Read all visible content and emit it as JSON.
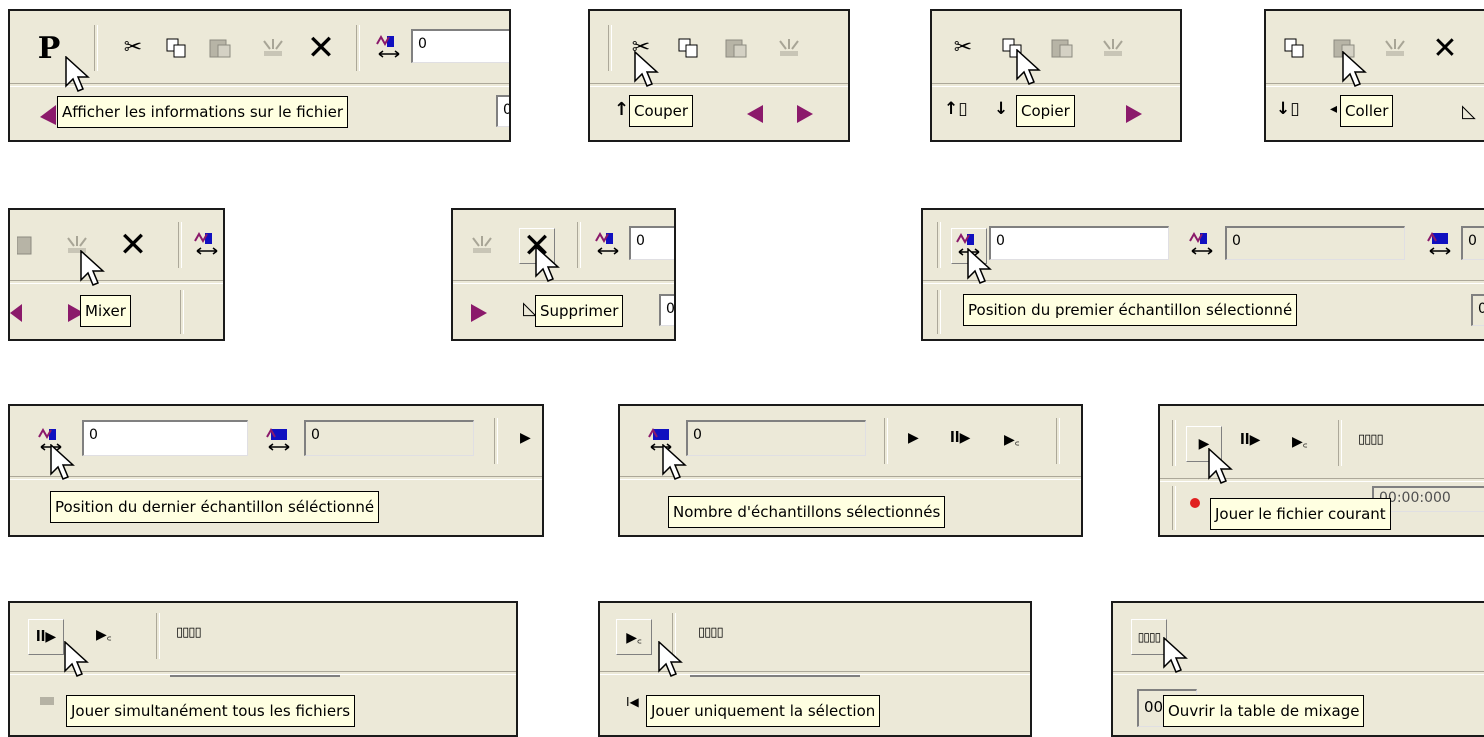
{
  "tooltips": {
    "info": "Afficher les informations sur le fichier",
    "cut": "Couper",
    "copy": "Copier",
    "paste": "Coller",
    "mix": "Mixer",
    "delete": "Supprimer",
    "first_sample": "Position du premier échantillon sélectionné",
    "last_sample": "Position du dernier échantillon séléctionné",
    "sample_count": "Nombre d'échantillons sélectionnés",
    "play": "Jouer le fichier courant",
    "play_all": "Jouer simultanément tous les fichiers",
    "play_selection": "Jouer uniquement la sélection",
    "mix_table": "Ouvrir la table de mixage"
  },
  "fields": {
    "zero": "0",
    "time_partial": "0:",
    "time_partial2": "0:00",
    "time_full": "00:00:000",
    "time_prefix": "00",
    "cut_first": "0"
  },
  "colors": {
    "toolbar_bg": "#ece9d8",
    "tooltip_bg": "#ffffe1",
    "accent_purple": "#8b1a6b",
    "record_red": "#e02020"
  }
}
